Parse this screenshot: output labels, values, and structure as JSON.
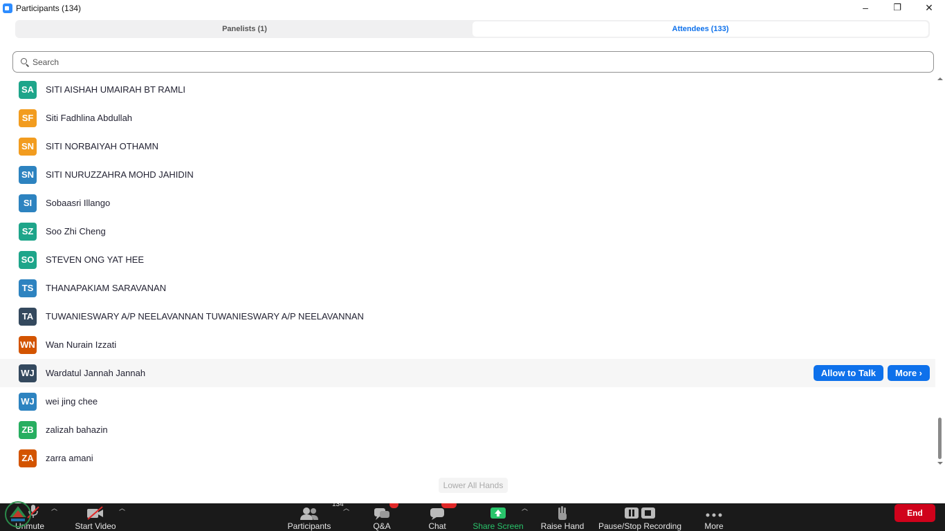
{
  "window": {
    "title": "Participants (134)",
    "minimize": "–",
    "restore": "❐",
    "close": "✕"
  },
  "tabs": [
    {
      "label": "Panelists (1)",
      "active": false
    },
    {
      "label": "Attendees (133)",
      "active": true
    }
  ],
  "search": {
    "placeholder": "Search",
    "value": ""
  },
  "participants": [
    {
      "initials": "SA",
      "name": "SITI AISHAH UMAIRAH BT RAMLI",
      "color": "#1ea58a"
    },
    {
      "initials": "SF",
      "name": "Siti Fadhlina Abdullah",
      "color": "#f29c1f"
    },
    {
      "initials": "SN",
      "name": "SITI NORBAIYAH OTHAMN",
      "color": "#f29c1f"
    },
    {
      "initials": "SN",
      "name": "SITI NURUZZAHRA MOHD JAHIDIN",
      "color": "#2d83c0"
    },
    {
      "initials": "SI",
      "name": "Sobaasri Illango",
      "color": "#2d83c0"
    },
    {
      "initials": "SZ",
      "name": "Soo Zhi Cheng",
      "color": "#1ea58a"
    },
    {
      "initials": "SO",
      "name": "STEVEN ONG YAT HEE",
      "color": "#1ea58a"
    },
    {
      "initials": "TS",
      "name": "THANAPAKIAM SARAVANAN",
      "color": "#2d83c0"
    },
    {
      "initials": "TA",
      "name": "TUWANIESWARY A/P NEELAVANNAN TUWANIESWARY A/P NEELAVANNAN",
      "color": "#34495e"
    },
    {
      "initials": "WN",
      "name": "Wan Nurain Izzati",
      "color": "#d35400"
    },
    {
      "initials": "WJ",
      "name": "Wardatul Jannah Jannah",
      "color": "#34495e"
    },
    {
      "initials": "WJ",
      "name": "wei jing chee",
      "color": "#2d83c0"
    },
    {
      "initials": "ZB",
      "name": "zalizah bahazin",
      "color": "#27ae60"
    },
    {
      "initials": "ZA",
      "name": "zarra amani",
      "color": "#d35400"
    }
  ],
  "hovered_row": {
    "allow_to_talk": "Allow to Talk",
    "more": "More ›"
  },
  "lower_all_hands": "Lower All Hands",
  "toolbar": {
    "unmute": "Unmute",
    "start_video": "Start Video",
    "participants": "Participants",
    "participants_count": "134",
    "qa": "Q&A",
    "chat": "Chat",
    "share_screen": "Share Screen",
    "raise_hand": "Raise Hand",
    "recording": "Pause/Stop Recording",
    "more": "More",
    "end": "End"
  },
  "colors": {
    "accent": "#0E71EB",
    "share_green": "#29c46b",
    "end_red": "#d0021b",
    "toolbar_bg": "#1a1a1a"
  }
}
